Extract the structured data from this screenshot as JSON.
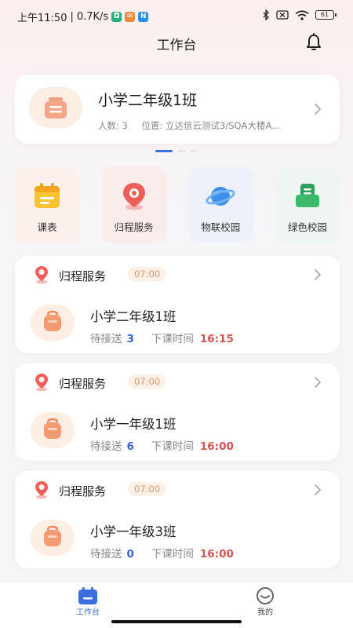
{
  "status_bar": {
    "time": "上午11:50",
    "speed": "0.7K/s",
    "battery": "61",
    "colors": {
      "app1": "#28b07c",
      "app2": "#f08a3c",
      "app3": "#2b8ee6"
    }
  },
  "header": {
    "title": "工作台"
  },
  "class_card": {
    "title": "小学二年级1班",
    "count": "人数: 3",
    "location": "位置: 立达信云测试3/SQA大楼A..."
  },
  "quick": [
    {
      "label": "课表",
      "icon": "calendar-icon",
      "bg": "#fbf0ec"
    },
    {
      "label": "归程服务",
      "icon": "location-pin-icon",
      "bg": "#fbecec"
    },
    {
      "label": "物联校园",
      "icon": "planet-icon",
      "bg": "#eff1f9"
    },
    {
      "label": "绿色校园",
      "icon": "green-bag-icon",
      "bg": "#eff6f1"
    }
  ],
  "services": [
    {
      "name": "归程服务",
      "time": "07:00",
      "class": "小学二年级1班",
      "pickup_label": "待接送",
      "pickup": "3",
      "end_label": "下课时间",
      "end": "16:15"
    },
    {
      "name": "归程服务",
      "time": "07:00",
      "class": "小学一年级1班",
      "pickup_label": "待接送",
      "pickup": "6",
      "end_label": "下课时间",
      "end": "16:00"
    },
    {
      "name": "归程服务",
      "time": "07:00",
      "class": "小学一年级3班",
      "pickup_label": "待接送",
      "pickup": "0",
      "end_label": "下课时间",
      "end": "16:00"
    }
  ],
  "tabs": [
    {
      "label": "工作台",
      "active": true,
      "color": "#3b6fe0"
    },
    {
      "label": "我的",
      "active": false,
      "color": "#666666"
    }
  ]
}
